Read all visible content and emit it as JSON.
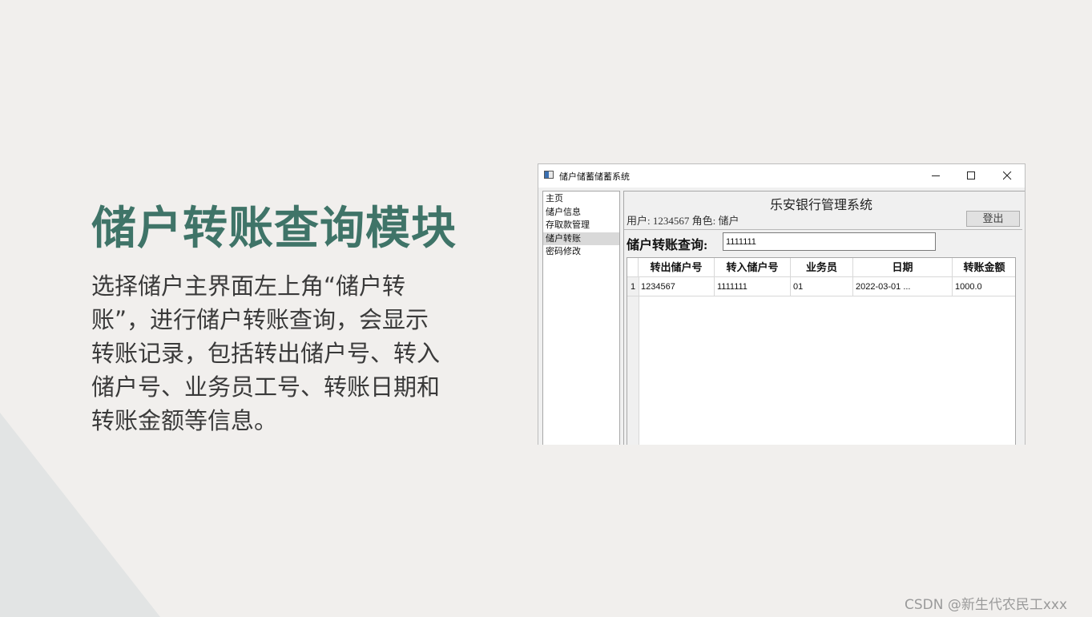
{
  "slide": {
    "title": "储户转账查询模块",
    "body_lines": [
      "选择储户主界面左上角“储户转",
      "账”，进行储户转账查询，会显示",
      "转账记录，包括转出储户号、转入",
      "储户号、业务员工号、转账日期和",
      "转账金额等信息。"
    ]
  },
  "window": {
    "title": "储户储蓄储蓄系统",
    "controls": {
      "minimize": "minimize-icon",
      "maximize": "maximize-icon",
      "close": "close-icon"
    }
  },
  "sidebar": {
    "items": [
      {
        "label": "主页",
        "selected": false
      },
      {
        "label": "储户信息",
        "selected": false
      },
      {
        "label": "存取款管理",
        "selected": false
      },
      {
        "label": "储户转账",
        "selected": true
      },
      {
        "label": "密码修改",
        "selected": false
      }
    ]
  },
  "main": {
    "bank_title": "乐安银行管理系统",
    "user_info": "用户: 1234567 角色: 储户",
    "logout_label": "登出",
    "query_label": "储户转账查询:",
    "query_value": "1111111"
  },
  "table": {
    "columns": [
      "转出储户号",
      "转入储户号",
      "业务员",
      "日期",
      "转账金额"
    ],
    "rows": [
      {
        "index": "1",
        "cells": [
          "1234567",
          "1111111",
          "01",
          "2022-03-01 ...",
          "1000.0"
        ]
      }
    ]
  },
  "watermark": "CSDN @新生代农民工xxx",
  "colors": {
    "background": "#f1efed",
    "title_accent": "#3f7468",
    "corner_shape": "#e2e4e4"
  }
}
